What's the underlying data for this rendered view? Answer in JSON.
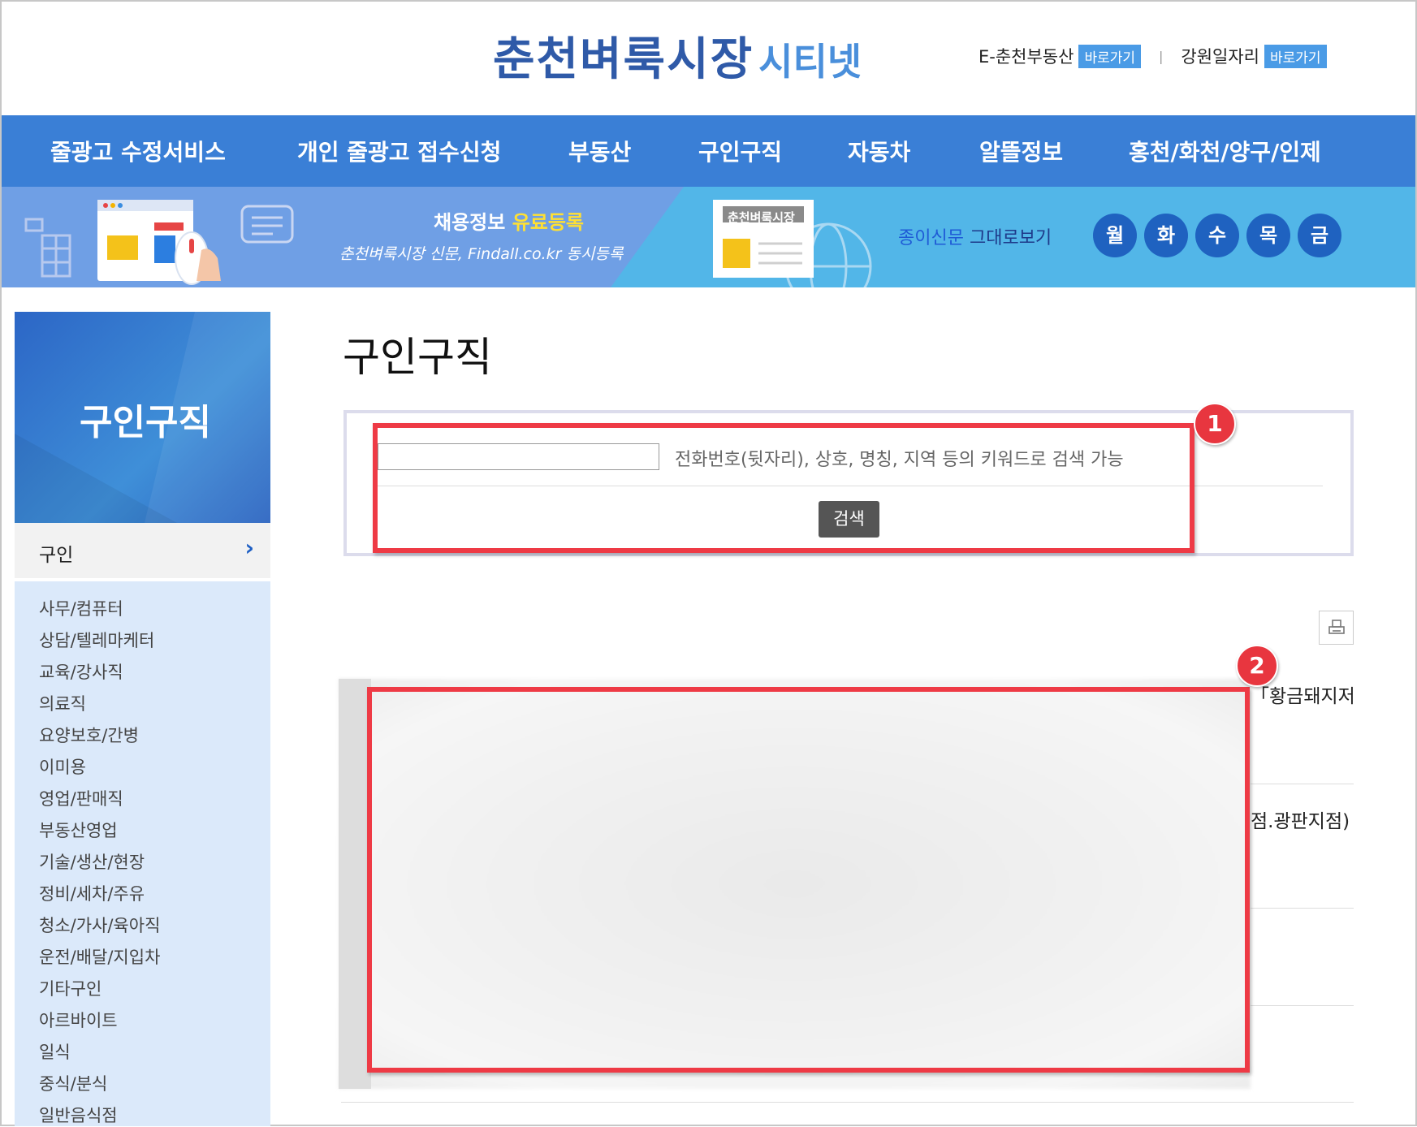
{
  "header": {
    "logo_main": "춘천벼룩시장",
    "logo_sub": "시티넷",
    "links": [
      {
        "label": "E-춘천부동산",
        "button": "바로가기"
      },
      {
        "label": "강원일자리",
        "button": "바로가기"
      }
    ],
    "separator": "|"
  },
  "nav": {
    "items": [
      "줄광고 수정서비스",
      "개인 줄광고 접수신청",
      "부동산",
      "구인구직",
      "자동차",
      "알뜰정보",
      "홍천/화천/양구/인제"
    ]
  },
  "banner": {
    "title_prefix": "채용정보",
    "title_highlight": "유료등록",
    "subtitle": "춘천벼룩시장 신문, Findall.co.kr 동시등록",
    "paper_label": "춘천벼룩시장",
    "paper_link_prefix": "종이신문",
    "paper_link_suffix": "그대로보기",
    "days": [
      "월",
      "화",
      "수",
      "목",
      "금"
    ]
  },
  "sidebar": {
    "title": "구인구직",
    "active": {
      "label": "구인",
      "chevron": "›"
    },
    "items": [
      "사무/컴퓨터",
      "상담/텔레마케터",
      "교육/강사직",
      "의료직",
      "요양보호/간병",
      "이미용",
      "영업/판매직",
      "부동산영업",
      "기술/생산/현장",
      "정비/세차/주유",
      "청소/가사/육아직",
      "운전/배달/지입차",
      "기타구인",
      "아르바이트",
      "일식",
      "중식/분식",
      "일반음식점"
    ]
  },
  "main": {
    "page_title": "구인구직",
    "search": {
      "value": "",
      "hint": "전화번호(뒷자리), 상호, 명칭, 지역 등의 키워드로 검색 가능",
      "button": "검색"
    },
    "print_icon": "printer-icon",
    "rows": [
      "「황금돼지저",
      "점.광판지점)"
    ]
  },
  "annotations": {
    "badges": [
      "1",
      "2"
    ],
    "color": "#ee3a45"
  },
  "colors": {
    "nav_bg": "#3a7fd6",
    "banner_bg": "#52b6e8",
    "sidebar_bg": "#dbe9fa",
    "accent": "#1f62c0"
  }
}
